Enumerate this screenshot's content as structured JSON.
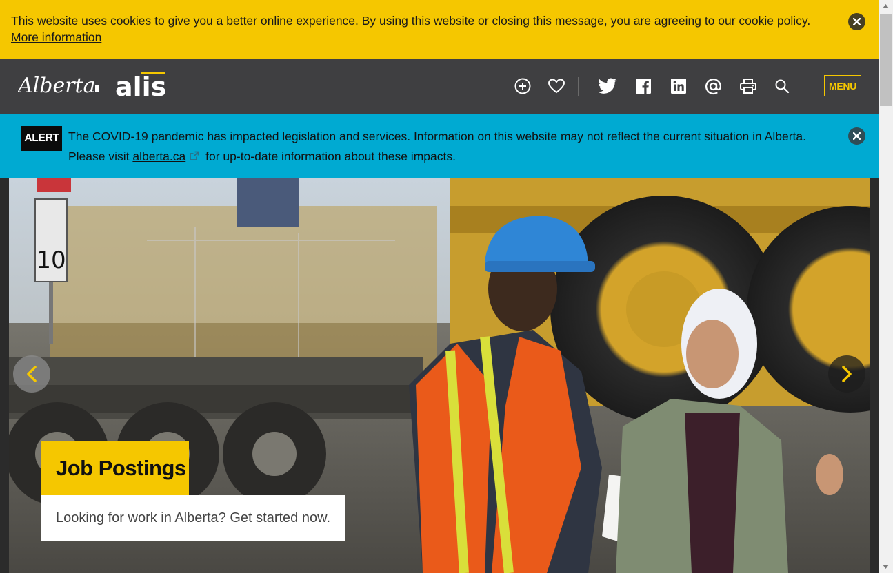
{
  "cookie": {
    "message": "This website uses cookies to give you a better online experience. By using this website or closing this message, you are agreeing to our cookie policy.",
    "link_label": "More information"
  },
  "header": {
    "logo_alberta": "Alberta",
    "logo_alis": "alis",
    "icons": [
      "add-circle-icon",
      "heart-icon",
      "twitter-icon",
      "facebook-icon",
      "linkedin-icon",
      "email-at-icon",
      "print-icon",
      "search-icon"
    ],
    "menu_label": "MENU",
    "accent_color": "#f5c700",
    "background_color": "#3f3f41"
  },
  "alert": {
    "badge": "ALERT",
    "text_line1": "The COVID-19 pandemic has impacted legislation and services. Information on this website may not reflect the current situation in Alberta.",
    "text_prefix": "Please visit",
    "link_label": "alberta.ca",
    "text_suffix": "for up-to-date information about these impacts.",
    "background_color": "#00aad2"
  },
  "hero": {
    "title": "Job Postings",
    "subtitle": "Looking for work in Alberta? Get started now.",
    "sign_speed": "10",
    "prev_icon": "chevron-left-icon",
    "next_icon": "chevron-right-icon"
  }
}
